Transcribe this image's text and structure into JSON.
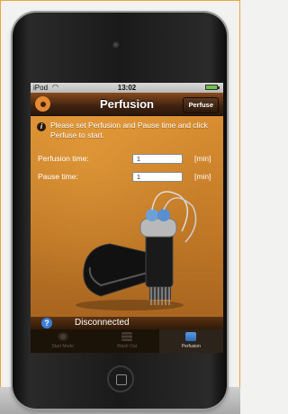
{
  "status_bar": {
    "carrier": "iPod",
    "time": "13:02"
  },
  "nav": {
    "title": "Perfusion",
    "action_label": "Perfuse"
  },
  "instructions": "Please set Perfusion and Pause time and click Perfuse to start.",
  "fields": [
    {
      "label": "Perfusion time:",
      "value": "1",
      "unit": "[min]"
    },
    {
      "label": "Pause time:",
      "value": "1",
      "unit": "[min]"
    }
  ],
  "connection": {
    "help_symbol": "?",
    "status": "Disconnected"
  },
  "tabs": [
    {
      "label": "Start Mode",
      "icon": "gear-icon",
      "active": false
    },
    {
      "label": "Wash Out",
      "icon": "list-icon",
      "active": false
    },
    {
      "label": "Perfusion",
      "icon": "calculator-icon",
      "active": true
    }
  ],
  "colors": {
    "accent": "#d98e32",
    "nav_bar": "#3e2210",
    "help_blue": "#3a7ed8"
  }
}
